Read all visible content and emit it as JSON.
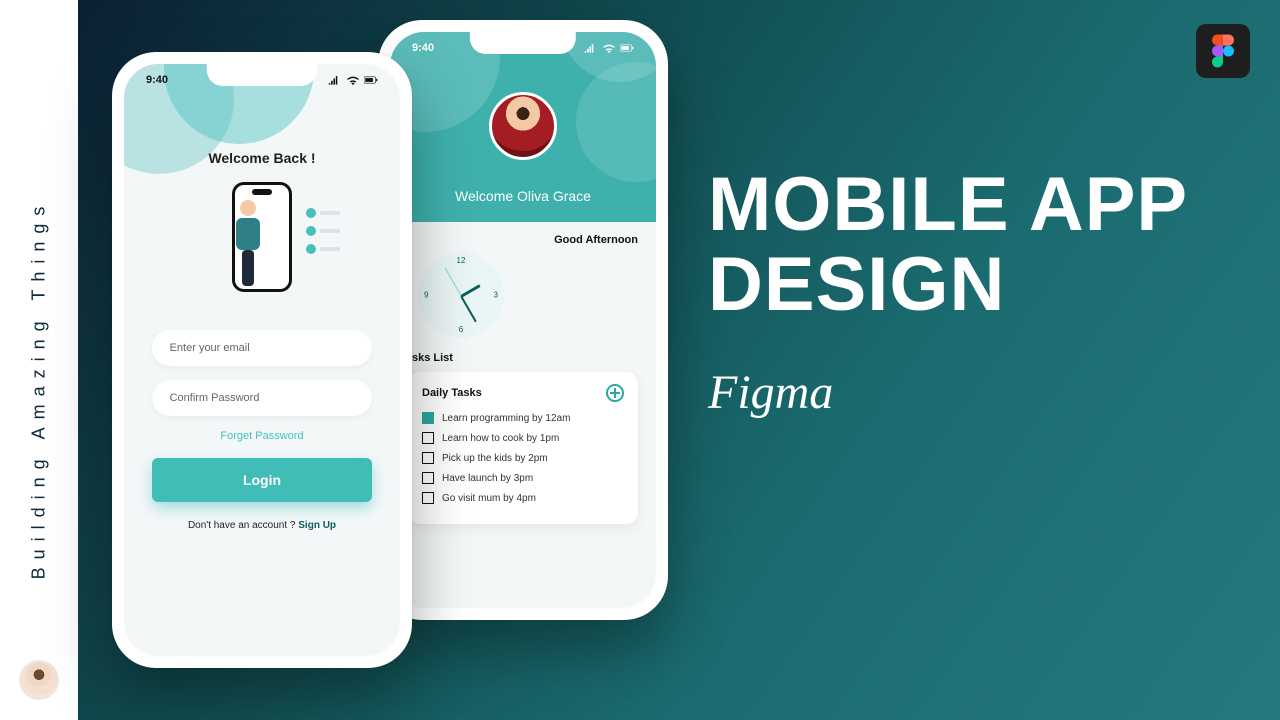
{
  "left_rail": {
    "text": "Building Amazing Things"
  },
  "title": {
    "line1": "MOBILE APP",
    "line2": "DESIGN",
    "tool": "Figma"
  },
  "status": {
    "time": "9:40"
  },
  "phone_a": {
    "title": "Welcome Back !",
    "email_placeholder": "Enter your email",
    "password_placeholder": "Confirm Password",
    "forgot": "Forget Password",
    "login": "Login",
    "signup_prefix": "Don't have an account ? ",
    "signup_link": "Sign Up"
  },
  "phone_b": {
    "welcome": "Welcome Oliva Grace",
    "greeting": "Good Afternoon",
    "clock": {
      "n12": "12",
      "n3": "3",
      "n6": "6",
      "n9": "9"
    },
    "list_label": "sks List",
    "card_title": "Daily Tasks",
    "tasks": [
      {
        "done": true,
        "text": "Learn programming by 12am"
      },
      {
        "done": false,
        "text": "Learn how to cook by 1pm"
      },
      {
        "done": false,
        "text": "Pick up the kids by 2pm"
      },
      {
        "done": false,
        "text": "Have launch by 3pm"
      },
      {
        "done": false,
        "text": "Go visit mum by 4pm"
      }
    ]
  }
}
